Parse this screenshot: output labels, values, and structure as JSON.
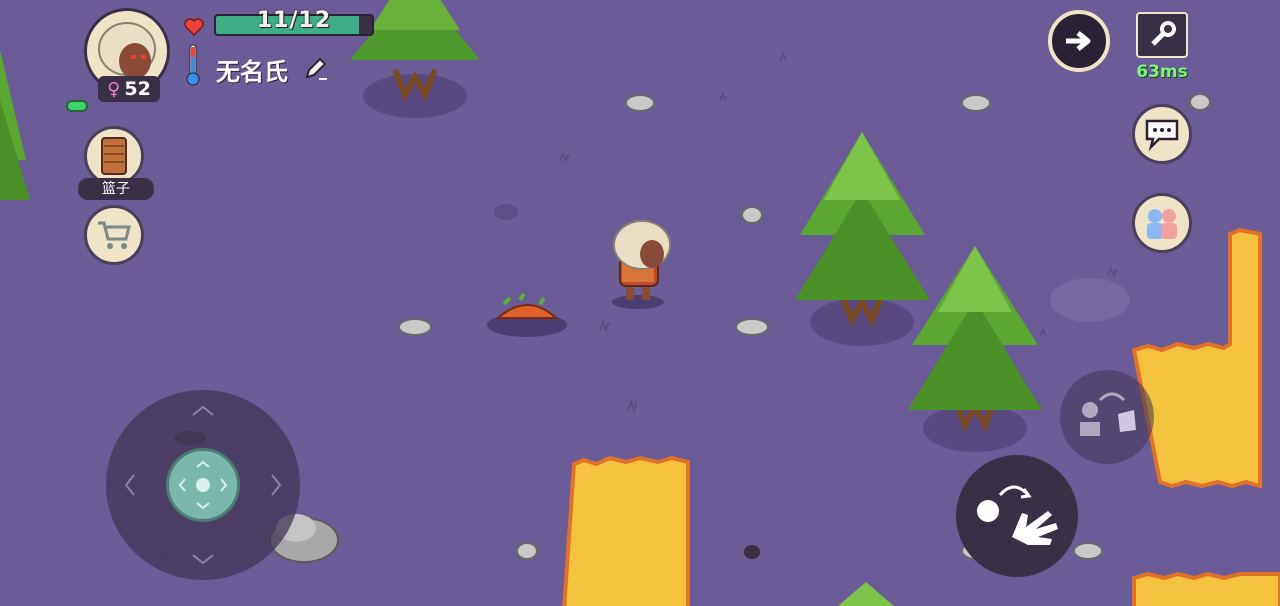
{
  "player": {
    "name": "无名氏",
    "gender_symbol": "♀",
    "age": "52",
    "health_text": "11/12",
    "health_fraction": 0.917
  },
  "items": {
    "basket_label": "篮子"
  },
  "network": {
    "ping": "63ms"
  },
  "icons": {
    "heart": "heart-icon",
    "thermometer": "thermometer-icon",
    "edit": "pencil-icon",
    "basket": "basket-icon",
    "shop": "shopping-cart-icon",
    "next": "arrow-right-icon",
    "settings": "wrench-icon",
    "chat": "speech-bubble-icon",
    "social": "people-icon",
    "rotate": "rotate-icon",
    "grab": "hand-icon"
  },
  "colors": {
    "ground": "#6b5b96",
    "health": "#3fae86",
    "ping": "#7df27a",
    "fire": "#f4c23e"
  }
}
